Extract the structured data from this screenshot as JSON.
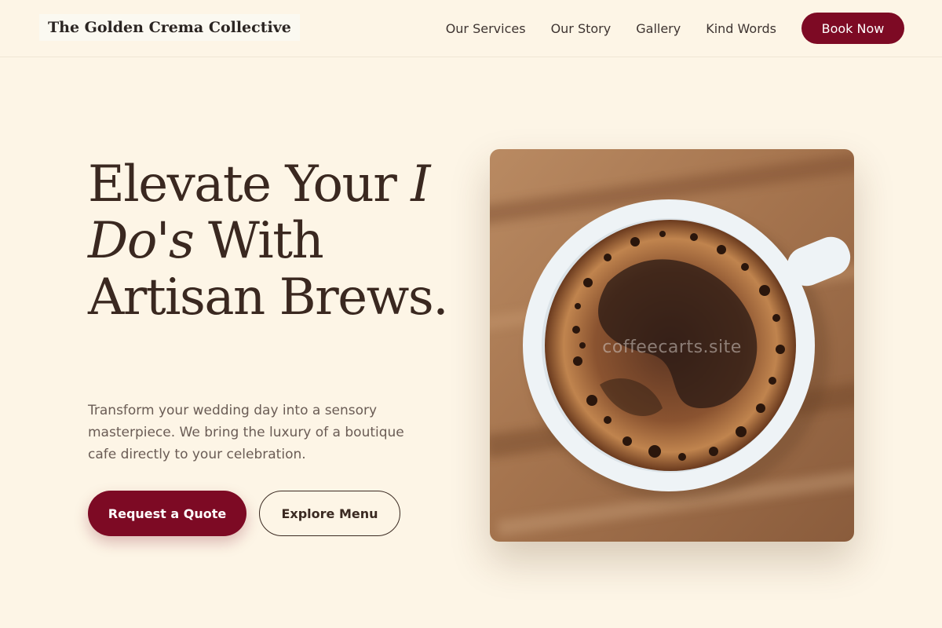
{
  "brand": {
    "name": "The Golden Crema Collective"
  },
  "nav": {
    "links": [
      "Our Services",
      "Our Story",
      "Gallery",
      "Kind Words"
    ],
    "cta": "Book Now"
  },
  "hero": {
    "headline_part1": "Elevate Your ",
    "headline_italic": "I Do's",
    "headline_part2": " With Artisan Brews.",
    "subtitle": "Transform your wedding day into a sensory masterpiece. We bring the luxury of a boutique cafe directly to your celebration.",
    "primary_button": "Request a Quote",
    "secondary_button": "Explore Menu",
    "image": {
      "description": "coffee-cup-top-view",
      "watermark": "coffeecarts.site"
    }
  },
  "colors": {
    "background": "#fdf5e6",
    "accent": "#7d0a24",
    "heading": "#3a2820",
    "body_text": "#6a5c55"
  }
}
